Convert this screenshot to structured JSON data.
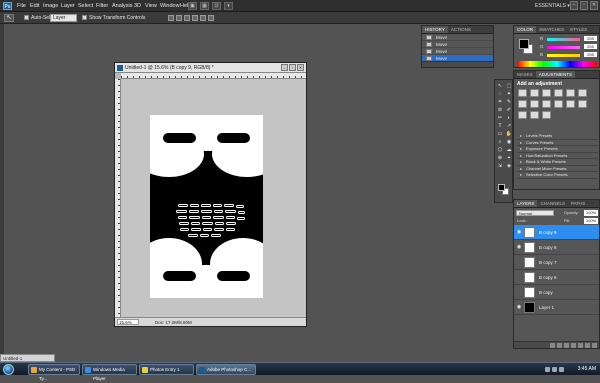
{
  "app": {
    "logo": "Ps",
    "menu": [
      "File",
      "Edit",
      "Image",
      "Layer",
      "Select",
      "Filter",
      "Analysis",
      "3D",
      "View",
      "Window",
      "Help"
    ],
    "workspace": "ESSENTIALS",
    "workspace_arrow": "▾",
    "window_buttons": [
      "–",
      "▫",
      "✕"
    ],
    "top_icons": [
      "▣",
      "▦",
      "⊡",
      "▾"
    ]
  },
  "options": {
    "tool_glyph": "↖",
    "auto_select_label": "Auto-Select:",
    "auto_select_value": "Layer",
    "show_transform_label": "Show Transform Controls"
  },
  "document": {
    "title": "Untitled-1 @ 15.6% (B copy 9, RGB/8) *",
    "window_buttons": [
      "–",
      "▫",
      "✕"
    ],
    "zoom": "15.6%",
    "info": "Doc: 17.2M/8.60M",
    "artwork_color_bg": "#000000",
    "artwork_color_fg": "#ffffff"
  },
  "history": {
    "tabs": [
      "HISTORY",
      "ACTIONS"
    ],
    "items": [
      "Move",
      "Move",
      "Move",
      "Move"
    ],
    "selected_index": 3
  },
  "color": {
    "tabs": [
      "COLOR",
      "SWATCHES",
      "STYLES"
    ],
    "sliders": [
      {
        "label": "R",
        "value": "255",
        "gradient": "#ff5a8a"
      },
      {
        "label": "G",
        "value": "255",
        "gradient": "#ff66ff"
      },
      {
        "label": "B",
        "value": "255",
        "gradient": "#ffcc00"
      }
    ],
    "foreground": "#000000",
    "background": "#ffffff"
  },
  "adjustments": {
    "tabs": [
      "MASKS",
      "ADJUSTMENTS"
    ],
    "title": "Add an adjustment",
    "icons": [
      "brightness-icon",
      "levels-icon",
      "curves-icon",
      "exposure-icon",
      "vibrance-icon",
      "hue-icon",
      "color-balance-icon",
      "black-white-icon",
      "photo-filter-icon",
      "channel-mixer-icon",
      "invert-icon",
      "posterize-icon",
      "threshold-icon",
      "gradient-map-icon",
      "selective-color-icon"
    ],
    "presets": [
      "Levels Presets",
      "Curves Presets",
      "Exposure Presets",
      "Hue/Saturation Presets",
      "Black & White Presets",
      "Channel Mixer Presets",
      "Selective Color Presets"
    ]
  },
  "tools": {
    "glyphs": [
      "↖",
      "⬚",
      "◌",
      "✦",
      "⌗",
      "✎",
      "⊘",
      "✐",
      "✂",
      "◐",
      "T",
      "↗",
      "▭",
      "✋",
      "⌕",
      "◉",
      "⬡",
      "☁",
      "⊕",
      "⌖",
      "⇲",
      "◈"
    ]
  },
  "layers": {
    "tabs": [
      "LAYERS",
      "CHANNELS",
      "PATHS"
    ],
    "blend_mode": "Normal",
    "opacity_label": "Opacity:",
    "opacity": "100%",
    "lock_label": "Lock:",
    "fill_label": "Fill:",
    "fill": "100%",
    "eye_glyph": "◉",
    "items": [
      {
        "name": "B copy 9",
        "visible": true,
        "selected": true,
        "thumb": "light"
      },
      {
        "name": "B copy 8",
        "visible": true,
        "selected": false,
        "thumb": "light"
      },
      {
        "name": "B copy 7",
        "visible": false,
        "selected": false,
        "thumb": "light"
      },
      {
        "name": "B copy 6",
        "visible": false,
        "selected": false,
        "thumb": "light"
      },
      {
        "name": "B copy",
        "visible": false,
        "selected": false,
        "thumb": "light"
      },
      {
        "name": "Layer 1",
        "visible": true,
        "selected": false,
        "thumb": "dark"
      }
    ]
  },
  "minimized_doc": "Untitled-1",
  "taskbar": {
    "buttons": [
      {
        "label": "My Content - PSD Ty...",
        "icon_color": "#e8a33c",
        "active": false
      },
      {
        "label": "Windows Media Player",
        "icon_color": "#3c8ee8",
        "active": false
      },
      {
        "label": "Photos Entry 1",
        "icon_color": "#e8d23c",
        "active": false
      },
      {
        "label": "Adobe Photoshop C...",
        "icon_color": "#1c5d8f",
        "active": true
      }
    ],
    "clock": "3:45 AM"
  }
}
